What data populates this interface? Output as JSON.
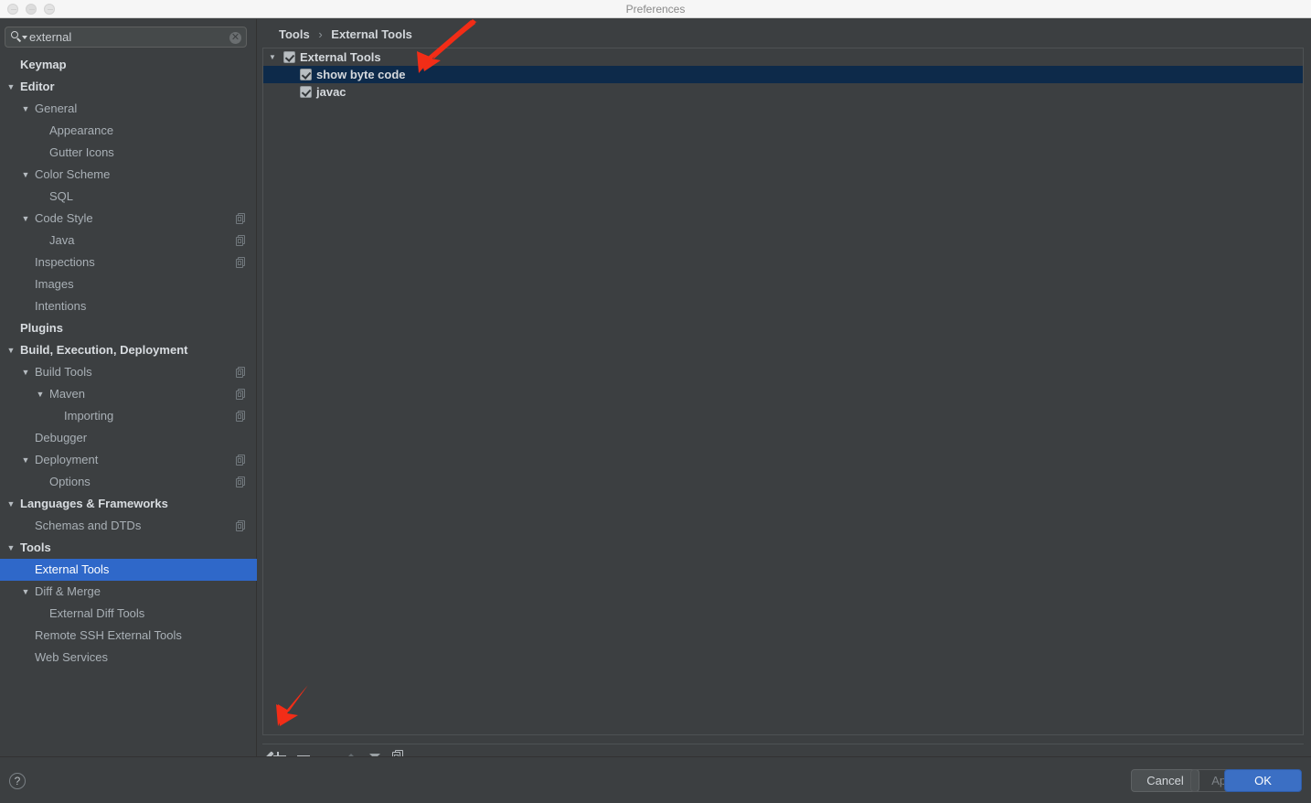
{
  "window": {
    "title": "Preferences",
    "traffic_lights": [
      "close",
      "minimize",
      "zoom"
    ]
  },
  "search": {
    "value": "external",
    "icon": "search-icon",
    "clear_icon": "✕"
  },
  "sidebar": {
    "selected": "External Tools",
    "items": [
      {
        "label": "Keymap",
        "indent": 0,
        "caret": "",
        "bold": true,
        "badge": false
      },
      {
        "label": "Editor",
        "indent": 0,
        "caret": "▼",
        "bold": true,
        "badge": false
      },
      {
        "label": "General",
        "indent": 1,
        "caret": "▼",
        "bold": false,
        "badge": false
      },
      {
        "label": "Appearance",
        "indent": 2,
        "caret": "",
        "bold": false,
        "badge": false
      },
      {
        "label": "Gutter Icons",
        "indent": 2,
        "caret": "",
        "bold": false,
        "badge": false
      },
      {
        "label": "Color Scheme",
        "indent": 1,
        "caret": "▼",
        "bold": false,
        "badge": false
      },
      {
        "label": "SQL",
        "indent": 2,
        "caret": "",
        "bold": false,
        "badge": false
      },
      {
        "label": "Code Style",
        "indent": 1,
        "caret": "▼",
        "bold": false,
        "badge": true
      },
      {
        "label": "Java",
        "indent": 2,
        "caret": "",
        "bold": false,
        "badge": true
      },
      {
        "label": "Inspections",
        "indent": 1,
        "caret": "",
        "bold": false,
        "badge": true
      },
      {
        "label": "Images",
        "indent": 1,
        "caret": "",
        "bold": false,
        "badge": false
      },
      {
        "label": "Intentions",
        "indent": 1,
        "caret": "",
        "bold": false,
        "badge": false
      },
      {
        "label": "Plugins",
        "indent": 0,
        "caret": "",
        "bold": true,
        "badge": false
      },
      {
        "label": "Build, Execution, Deployment",
        "indent": 0,
        "caret": "▼",
        "bold": true,
        "badge": false
      },
      {
        "label": "Build Tools",
        "indent": 1,
        "caret": "▼",
        "bold": false,
        "badge": true
      },
      {
        "label": "Maven",
        "indent": 2,
        "caret": "▼",
        "bold": false,
        "badge": true
      },
      {
        "label": "Importing",
        "indent": 3,
        "caret": "",
        "bold": false,
        "badge": true
      },
      {
        "label": "Debugger",
        "indent": 1,
        "caret": "",
        "bold": false,
        "badge": false
      },
      {
        "label": "Deployment",
        "indent": 1,
        "caret": "▼",
        "bold": false,
        "badge": true
      },
      {
        "label": "Options",
        "indent": 2,
        "caret": "",
        "bold": false,
        "badge": true
      },
      {
        "label": "Languages & Frameworks",
        "indent": 0,
        "caret": "▼",
        "bold": true,
        "badge": false
      },
      {
        "label": "Schemas and DTDs",
        "indent": 1,
        "caret": "",
        "bold": false,
        "badge": true
      },
      {
        "label": "Tools",
        "indent": 0,
        "caret": "▼",
        "bold": true,
        "badge": false
      },
      {
        "label": "External Tools",
        "indent": 1,
        "caret": "",
        "bold": false,
        "badge": false
      },
      {
        "label": "Diff & Merge",
        "indent": 1,
        "caret": "▼",
        "bold": false,
        "badge": false
      },
      {
        "label": "External Diff Tools",
        "indent": 2,
        "caret": "",
        "bold": false,
        "badge": false
      },
      {
        "label": "Remote SSH External Tools",
        "indent": 1,
        "caret": "",
        "bold": false,
        "badge": false
      },
      {
        "label": "Web Services",
        "indent": 1,
        "caret": "",
        "bold": false,
        "badge": false
      }
    ]
  },
  "main": {
    "breadcrumb": {
      "parent": "Tools",
      "separator": "›",
      "current": "External Tools"
    },
    "tree": [
      {
        "label": "External Tools",
        "indent": 0,
        "caret": "▼",
        "checked": true,
        "selected": false
      },
      {
        "label": "show byte code",
        "indent": 1,
        "caret": "",
        "checked": true,
        "selected": true
      },
      {
        "label": "javac",
        "indent": 1,
        "caret": "",
        "checked": true,
        "selected": false
      }
    ],
    "toolbar": [
      {
        "name": "add-button",
        "icon": "plus-icon",
        "enabled": true
      },
      {
        "name": "remove-button",
        "icon": "minus-icon",
        "enabled": true
      },
      {
        "name": "edit-button",
        "icon": "pencil-icon",
        "enabled": true
      },
      {
        "name": "move-up-button",
        "icon": "arrow-up-icon",
        "enabled": false
      },
      {
        "name": "move-down-button",
        "icon": "arrow-down-icon",
        "enabled": true
      },
      {
        "name": "copy-button",
        "icon": "copy-icon",
        "enabled": true
      }
    ]
  },
  "footer": {
    "help_label": "?",
    "cancel_label": "Cancel",
    "apply_label": "Apply",
    "ok_label": "OK"
  },
  "annotations": [
    {
      "name": "arrow-to-show-byte-code",
      "color": "#f22d17"
    },
    {
      "name": "arrow-to-add-button",
      "color": "#f22d17"
    }
  ],
  "colors": {
    "window_bg": "#3c3f41",
    "titlebar_bg": "#f6f6f6",
    "sidebar_selection": "#2f68c9",
    "tree_selection": "#0d2a4a",
    "accent": "#3b6fc4",
    "annotation_red": "#f22d17"
  }
}
